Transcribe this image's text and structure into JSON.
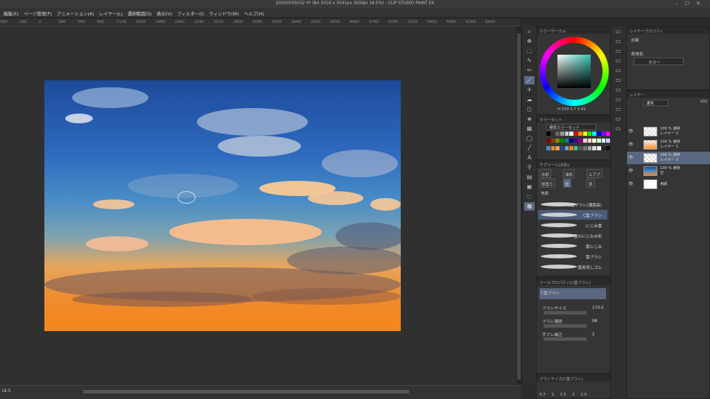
{
  "window": {
    "title": "20200509152 0* (B4 5016 x 3541px 350dpi 18.5%) - CLIP STUDIO PAINT EX"
  },
  "menu": [
    "編集(E)",
    "ページ管理(P)",
    "アニメーション(A)",
    "レイヤー(L)",
    "選択範囲(S)",
    "表示(V)",
    "フィルター(I)",
    "ウィンドウ(W)",
    "ヘルプ(H)"
  ],
  "ruler": [
    "560",
    "280",
    "0",
    "280",
    "560",
    "840",
    "1120",
    "1400",
    "1680",
    "1960",
    "2240",
    "2520",
    "2800",
    "3080",
    "3360",
    "3640",
    "3920",
    "4200",
    "4480",
    "4760",
    "5040",
    "5320",
    "5600",
    "5880",
    "6160",
    "6440"
  ],
  "status": {
    "zoom": "18.5"
  },
  "colorwheel": {
    "title": "カラーサークル",
    "hsv": "H 159  S 7  V 61",
    "selected_color": "#35c4b5"
  },
  "colorset": {
    "title": "カラーセット",
    "set_name": "標準カラーセット"
  },
  "subtool": {
    "title": "サブツール[水彩]",
    "tabs": [
      "水彩",
      "油彩",
      "エアブ",
      "厚塗り",
      "雲",
      "草"
    ],
    "group": "地面",
    "brushes": [
      "C雲ブラシ(濃度高)",
      "C雲ブラシ",
      "にじみ雲",
      "雲のにじみ水彩",
      "雲にじみ",
      "雲ブラシ",
      "雲用消しゴム"
    ]
  },
  "toolprop": {
    "title": "ツールプロパティ[C雲ブラシ]",
    "brush_name": "C雲ブラシ",
    "brush_size_label": "ブラシサイズ",
    "brush_size": "170.0",
    "brush_density_label": "ブラシ濃度",
    "brush_density": "98",
    "stabilize_label": "手ブレ補正",
    "stabilize": "2"
  },
  "brushsize": {
    "title": "ブラシサイズ[C雲ブラシ]",
    "sizes": [
      "0.7",
      "1",
      "1.5",
      "2",
      "2.5"
    ]
  },
  "layerprop": {
    "title": "レイヤープロパティ",
    "effect": "効果",
    "expression_label": "表現色",
    "expression": "カラー"
  },
  "layers": {
    "title": "レイヤー",
    "blend": "通常",
    "opacity": "100",
    "items": [
      {
        "line1": "100 % 通常",
        "line2": "レイヤー 2",
        "active": false
      },
      {
        "line1": "100 % 通常",
        "line2": "レイヤー 1",
        "active": false
      },
      {
        "line1": "100 % 通常",
        "line2": "レイヤー 3",
        "active": true
      },
      {
        "line1": "100 % 通常",
        "line2": "空",
        "active": false
      },
      {
        "line1": "",
        "line2": "用紙",
        "active": false
      }
    ]
  }
}
